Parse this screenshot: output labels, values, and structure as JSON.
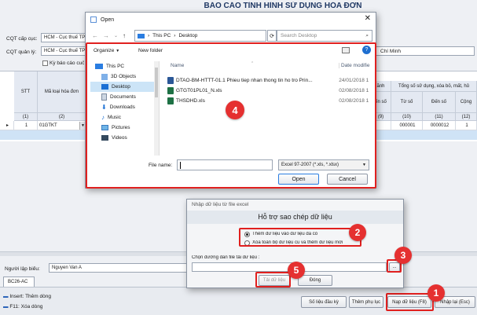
{
  "app": {
    "title": "BÁO CÁO TÌNH HÌNH SỬ DỤNG HÓA ĐƠN"
  },
  "filters": {
    "cqt_cap_cuc_label": "CQT cấp cục:",
    "cqt_cap_cuc_value": "HCM - Cục thuế TPH",
    "cqt_quan_ly_label": "CQT quản lý:",
    "cqt_quan_ly_value": "HCM - Cục thuế TPH",
    "ky_bao_cao_label": "Kỳ báo cáo cuối",
    "right_value": "Chí Minh"
  },
  "grid": {
    "left_headers": [
      "STT",
      "Mã loại hóa đơn"
    ],
    "col_numbers": [
      "(1)",
      "(2)"
    ],
    "right_top": "Tổng số sử dụng, xóa bỏ, mất, hủ",
    "right_sub": [
      "ãnh",
      "ến số",
      "Từ số",
      "Đến số",
      "Cộng"
    ],
    "right_nums": [
      "(9)",
      "(10)",
      "(11)",
      "(12)"
    ],
    "row": {
      "stt": "1",
      "code": "01GTKT",
      "from": "000001",
      "to": "0000012",
      "total": "1"
    }
  },
  "bottom": {
    "nguoi_lap_label": "Người lập biểu:",
    "nguoi_lap_value": "Nguyen Van A",
    "tab": "BC26-AC",
    "hint_insert": "Insert: Thêm dòng",
    "hint_f11": "F11: Xóa dòng",
    "btn_so_lieu": "Số liệu đầu kỳ",
    "btn_them_phu_luc": "Thêm phụ lục",
    "btn_nap": "Nạp dữ liệu (F8)",
    "btn_nhap_lai": "Nhập lại (Esc)"
  },
  "open_dialog": {
    "title": "Open",
    "path": [
      "This PC",
      "Desktop"
    ],
    "search_placeholder": "Search Desktop",
    "organize": "Organize",
    "new_folder": "New folder",
    "nav": [
      "This PC",
      "3D Objects",
      "Desktop",
      "Documents",
      "Downloads",
      "Music",
      "Pictures",
      "Videos"
    ],
    "col_name": "Name",
    "col_date": "Date modifie",
    "files": [
      {
        "name": "DTAO-BM-HTTT-01.1 Phieu tiep nhan thong tin ho tro Prin...",
        "date": "24/01/2018 1"
      },
      {
        "name": "GTGT01PL01_N.xls",
        "date": "02/08/2018 1"
      },
      {
        "name": "THSDHD.xls",
        "date": "02/08/2018 1"
      }
    ],
    "filename_label": "File name:",
    "filter": "Excel 97-2007 (*.xls, *.xlsx)",
    "btn_open": "Open",
    "btn_cancel": "Cancel"
  },
  "import_dialog": {
    "title": "Nhập dữ liệu từ file excel",
    "header": "Hỗ trợ sao chép dữ liệu",
    "opt1": "Thêm dữ liệu vào dữ liệu đã có",
    "opt2": "Xóa toàn bộ dữ liệu cũ và thêm dữ liệu mới",
    "path_label": "Chọn đường dẫn file tải dữ liệu :",
    "browse": "...",
    "btn_load": "Tải dữ liệu",
    "btn_close": "Đóng"
  },
  "badges": [
    "1",
    "2",
    "3",
    "4",
    "5"
  ],
  "colors": {
    "highlight": "#e0201f",
    "badge": "#e53030",
    "title": "#1f3864"
  }
}
